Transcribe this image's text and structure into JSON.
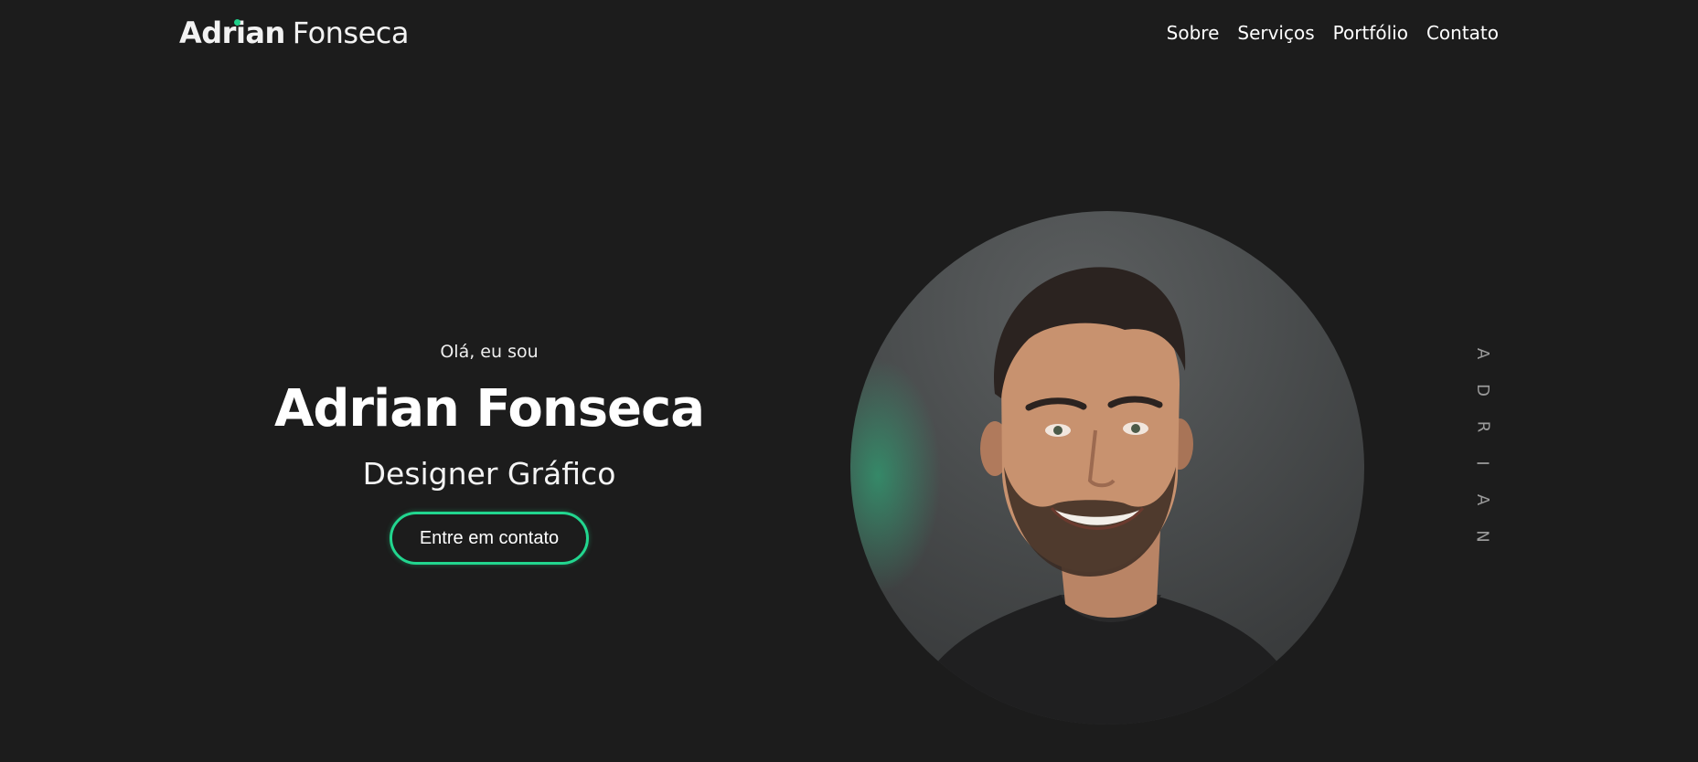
{
  "header": {
    "logo_first": "Adrian",
    "logo_last": "Fonseca",
    "nav": [
      {
        "label": "Sobre"
      },
      {
        "label": "Serviços"
      },
      {
        "label": "Portfólio"
      },
      {
        "label": "Contato"
      }
    ]
  },
  "hero": {
    "greeting": "Olá, eu sou",
    "name": "Adrian Fonseca",
    "role": "Designer Gráfico",
    "cta_label": "Entre em contato"
  },
  "side_text": {
    "letters": [
      "A",
      "D",
      "R",
      "I",
      "A",
      "N"
    ]
  },
  "portrait": {
    "icon": "portrait-photo"
  },
  "colors": {
    "background": "#1c1c1c",
    "accent": "#22d68f",
    "text": "#ffffff",
    "side_text": "#9a9a9a"
  }
}
